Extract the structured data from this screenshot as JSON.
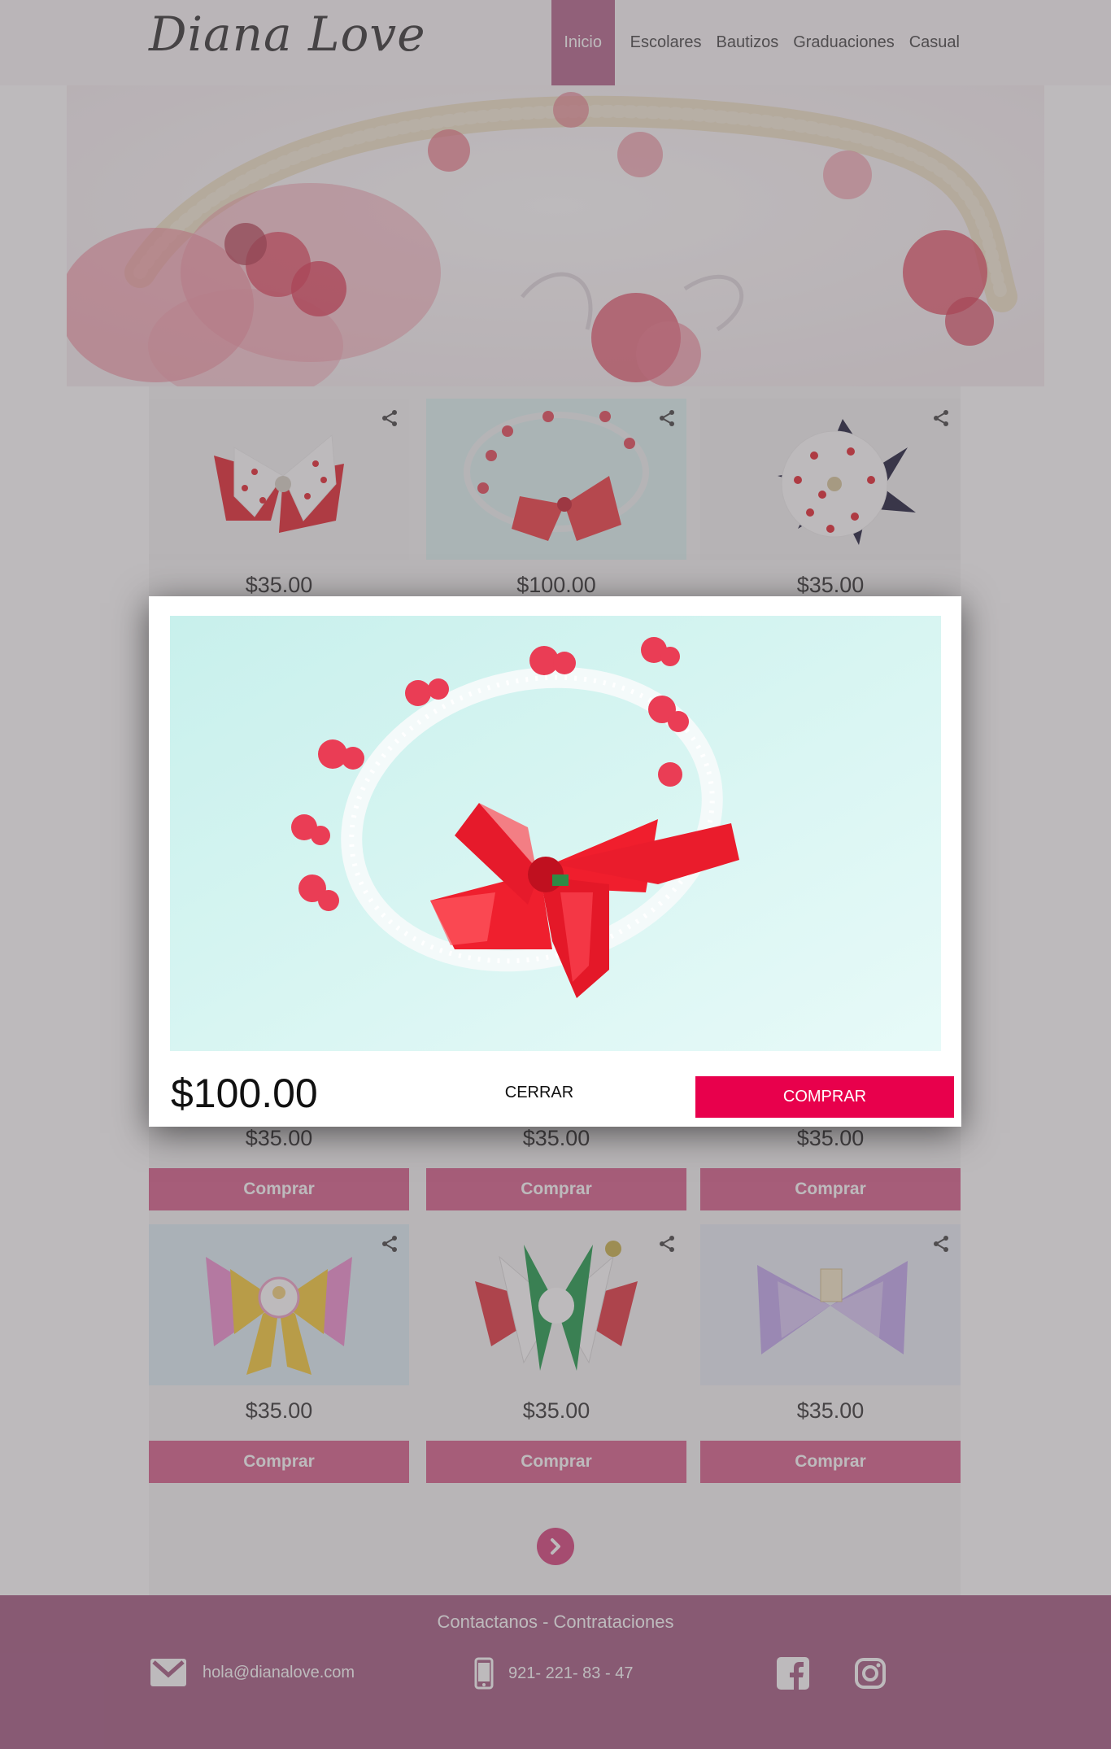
{
  "brand": {
    "logo_text": "Diana Love"
  },
  "nav": {
    "items": [
      {
        "label": "Inicio",
        "active": true
      },
      {
        "label": "Escolares"
      },
      {
        "label": "Bautizos"
      },
      {
        "label": "Graduaciones"
      },
      {
        "label": "Casual"
      }
    ]
  },
  "products": {
    "row1": [
      "$35.00",
      "$100.00",
      "$35.00"
    ],
    "row2": [
      "$35.00",
      "$35.00",
      "$35.00"
    ],
    "row3": [
      "$35.00",
      "$35.00",
      "$35.00"
    ],
    "buy_label": "Comprar"
  },
  "modal": {
    "price": "$100.00",
    "close_label": "CERRAR",
    "buy_label": "COMPRAR"
  },
  "footer": {
    "title": "Contactanos - Contrataciones",
    "email": "hola@dianalove.com",
    "phone": "921- 221- 83 - 47"
  },
  "colors": {
    "accent": "#d85f8c",
    "nav_active": "#b4658c",
    "footer_bg": "#a45a82",
    "modal_buy": "#e8004c"
  },
  "icons": [
    "share-icon",
    "chevron-right-icon",
    "mail-icon",
    "phone-icon",
    "facebook-icon",
    "instagram-icon"
  ]
}
